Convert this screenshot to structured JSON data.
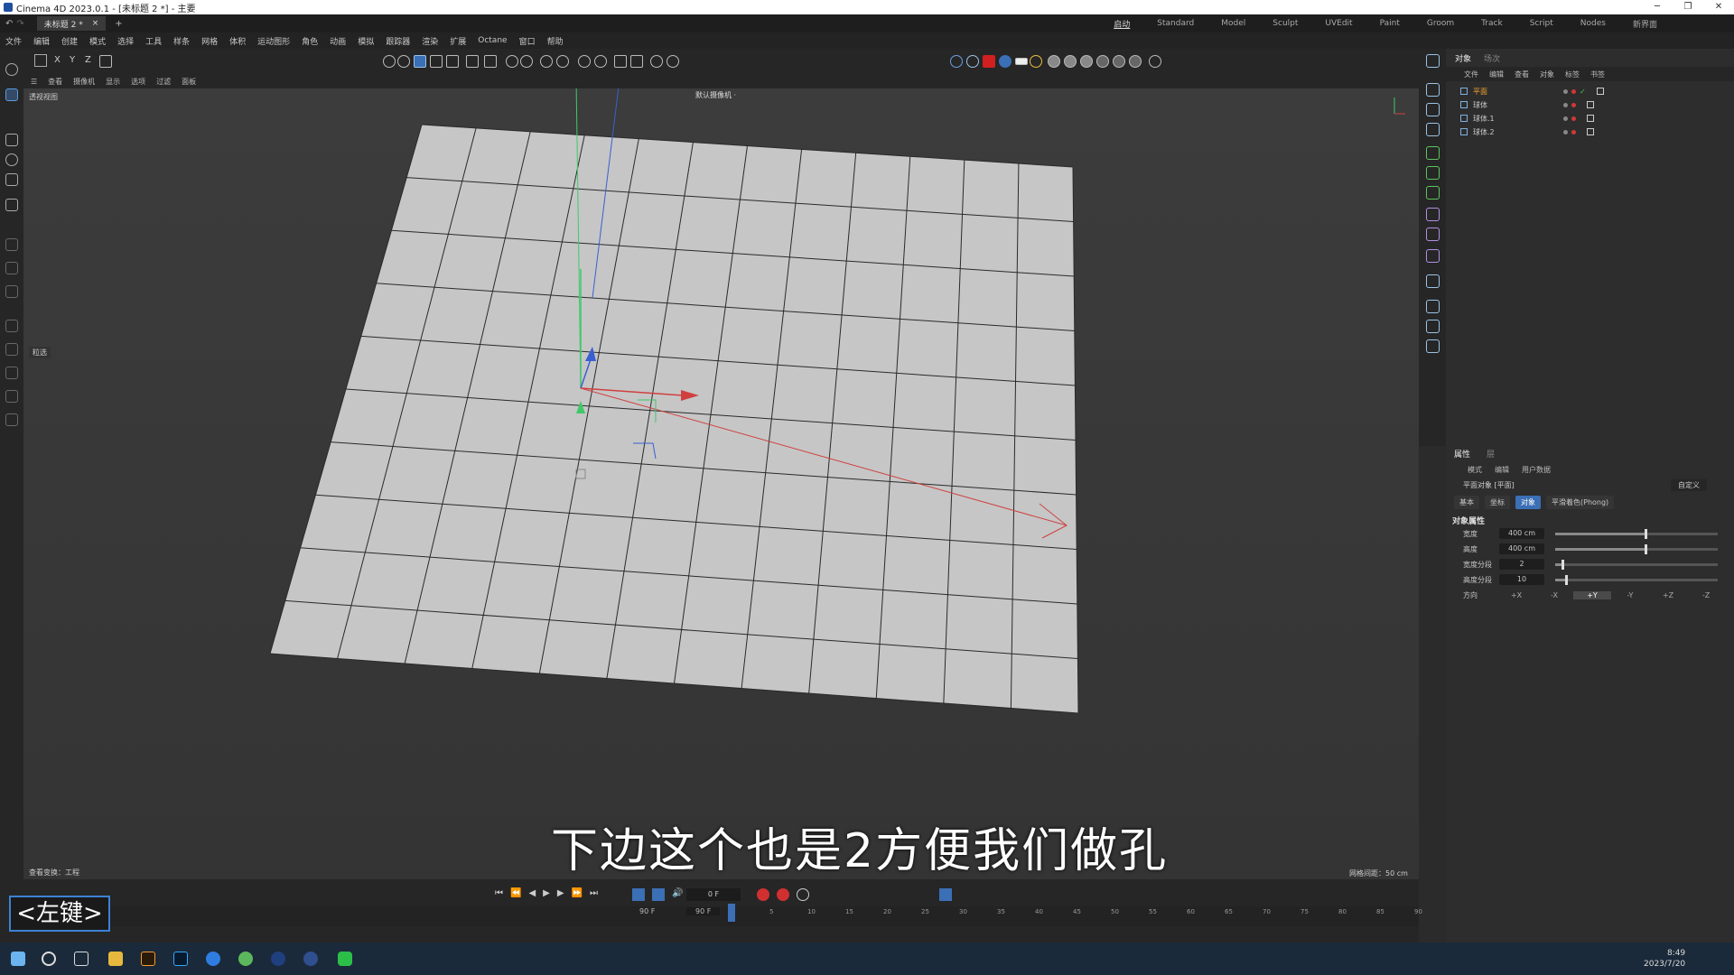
{
  "window": {
    "title": "Cinema 4D 2023.0.1 - [未标题 2 *] - 主要"
  },
  "tabs": {
    "doc": "未标题 2 *",
    "close": "×",
    "add": "+"
  },
  "layouts": [
    "启动",
    "Standard",
    "Model",
    "Sculpt",
    "UVEdit",
    "Paint",
    "Groom",
    "Track",
    "Script",
    "Nodes",
    "新界面"
  ],
  "menu": [
    "文件",
    "编辑",
    "创建",
    "模式",
    "选择",
    "工具",
    "样条",
    "网格",
    "体积",
    "运动图形",
    "角色",
    "动画",
    "模拟",
    "跟踪器",
    "渲染",
    "扩展",
    "Octane",
    "窗口",
    "帮助"
  ],
  "toolbar": {
    "x": "X",
    "y": "Y",
    "z": "Z"
  },
  "viewport": {
    "menu": [
      "查看",
      "摄像机",
      "显示",
      "选项",
      "过滤",
      "面板"
    ],
    "label": "透视视图",
    "camera": "默认摄像机 ·",
    "panel_label": "粒选",
    "view_transform": "查看变换：工程",
    "grid_info": "网格间距：50 cm",
    "subtitle": "下边这个也是2方便我们做孔"
  },
  "object_manager": {
    "tabs": [
      "对象",
      "场次"
    ],
    "menu": [
      "文件",
      "编辑",
      "查看",
      "对象",
      "标签",
      "书签"
    ],
    "objects": [
      {
        "name": "平面"
      },
      {
        "name": "球体"
      },
      {
        "name": "球体.1"
      },
      {
        "name": "球体.2"
      }
    ]
  },
  "attributes": {
    "tabs": [
      "属性",
      "层"
    ],
    "menu": [
      "模式",
      "编辑",
      "用户数据"
    ],
    "title": "平面对象 [平面]",
    "mode": "自定义",
    "subtabs": [
      "基本",
      "坐标",
      "对象",
      "平滑着色(Phong)"
    ],
    "active_subtab": "对象",
    "section": "对象属性",
    "props": [
      {
        "label": "宽度",
        "value": "400 cm",
        "fill": 0.55
      },
      {
        "label": "高度",
        "value": "400 cm",
        "fill": 0.55
      },
      {
        "label": "宽度分段",
        "value": "2",
        "fill": 0.04
      },
      {
        "label": "高度分段",
        "value": "10",
        "fill": 0.06
      }
    ],
    "orientation_label": "方向",
    "orientation": [
      "+X",
      "-X",
      "+Y",
      "-Y",
      "+Z",
      "-Z"
    ],
    "orientation_active": "+Y"
  },
  "timeline": {
    "current_frame": "0 F",
    "start": "90 F",
    "end": "90 F",
    "ticks": [
      "0",
      "5",
      "10",
      "15",
      "20",
      "25",
      "30",
      "35",
      "40",
      "45",
      "50",
      "55",
      "60",
      "65",
      "70",
      "75",
      "80",
      "85",
      "90"
    ]
  },
  "key_badge": "<左键>",
  "clock": {
    "time": "8:49",
    "date": "2023/7/20"
  }
}
